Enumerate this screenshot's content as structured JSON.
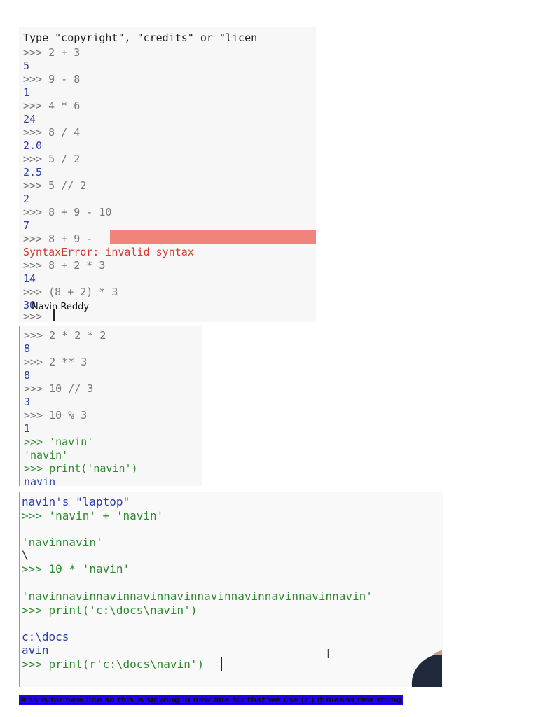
{
  "panel1": {
    "lines": [
      "Type \"copyright\", \"credits\" or \"licen",
      ">>> 2 + 3",
      "5",
      ">>> 9 - 8",
      "1",
      ">>> 4 * 6",
      "24",
      ">>> 8 / 4",
      "2.0",
      ">>> 5 / 2",
      "2.5",
      ">>> 5 // 2",
      "2",
      ">>> 8 + 9 - 10",
      "7",
      ">>> 8 + 9 -",
      "SyntaxError: invalid syntax",
      ">>> 8 + 2 * 3",
      "14",
      ">>> (8 + 2) * 3",
      "30",
      ">>>"
    ],
    "overlay_name": "Navin Reddy"
  },
  "panel2": {
    "lines": [
      ">>> 2 * 2 * 2",
      "8",
      ">>> 2 ** 3",
      "8",
      ">>> 10 // 3",
      "3",
      ">>> 10 % 3",
      "1",
      ">>> 'navin'",
      "'navin'",
      ">>> print('navin')",
      "navin"
    ]
  },
  "panel3": {
    "lines": [
      "navin's \"laptop\"",
      ">>> 'navin' + 'navin'",
      "",
      "'navinnavin'",
      "\\",
      ">>> 10 * 'navin'",
      "",
      "'navinnavinnavinnavinnavinnavinnavinnavinnavinnavin'",
      ">>> print('c:\\docs\\navin')",
      "",
      "c:\\docs",
      "avin",
      ">>> print(r'c:\\docs\\navin')"
    ]
  },
  "caption": "# \\n is for new line so this is sjowing in new line for that we use (r') it means raw string",
  "colors": {
    "highlight": "#f0847a",
    "caption_bg": "#1f00f2",
    "output_blue": "#2b3ea8",
    "string_green": "#2e8b2e",
    "error_red": "#d03a2a"
  }
}
